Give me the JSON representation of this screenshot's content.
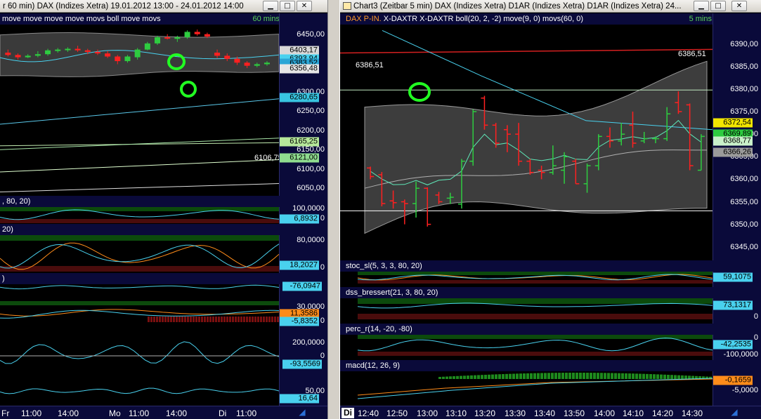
{
  "left": {
    "title": "r 60 min)  DAX (Indizes Xetra) 19.01.2012 13:00 - 24.01.2012 14:00",
    "price": {
      "header": "move move move move movs boll move movs",
      "timeframe": "60 mins",
      "ticks": [
        "6450,00",
        "6300,00",
        "6250,00",
        "6200,00",
        "6150,00",
        "6100,00",
        "6050,00"
      ],
      "tags": [
        {
          "text": "6403,17",
          "color": "#d8d8d8"
        },
        {
          "text": "6393,94",
          "color": "#49d1ee"
        },
        {
          "text": "6383,52",
          "color": "#2aa6d6"
        },
        {
          "text": "6356,48",
          "color": "#e6e6e6"
        },
        {
          "text": "6280,65",
          "color": "#38c4e0"
        },
        {
          "text": "6165,25",
          "color": "#b6e89a"
        },
        {
          "text": "6121,00",
          "color": "#8fdc8f"
        }
      ],
      "inline_label": "6106,75",
      "candles": [
        [
          6402,
          6410,
          6392,
          6396
        ],
        [
          6396,
          6400,
          6384,
          6390
        ],
        [
          6390,
          6398,
          6388,
          6394
        ],
        [
          6394,
          6406,
          6390,
          6398
        ],
        [
          6398,
          6412,
          6394,
          6408
        ],
        [
          6408,
          6414,
          6402,
          6410
        ],
        [
          6410,
          6416,
          6404,
          6412
        ],
        [
          6412,
          6420,
          6404,
          6408
        ],
        [
          6408,
          6412,
          6398,
          6404
        ],
        [
          6404,
          6410,
          6396,
          6400
        ],
        [
          6400,
          6406,
          6388,
          6392
        ],
        [
          6392,
          6396,
          6372,
          6380
        ],
        [
          6380,
          6396,
          6376,
          6392
        ],
        [
          6390,
          6414,
          6384,
          6410
        ],
        [
          6410,
          6430,
          6408,
          6426
        ],
        [
          6426,
          6446,
          6422,
          6442
        ],
        [
          6442,
          6450,
          6436,
          6440
        ],
        [
          6438,
          6446,
          6430,
          6442
        ],
        [
          6442,
          6460,
          6438,
          6456
        ],
        [
          6456,
          6462,
          6446,
          6450
        ],
        [
          6450,
          6454,
          6440,
          6444
        ],
        [
          6402,
          6410,
          6388,
          6394
        ],
        [
          6394,
          6400,
          6380,
          6386
        ],
        [
          6386,
          6392,
          6370,
          6376
        ],
        [
          6376,
          6380,
          6362,
          6368
        ],
        [
          6368,
          6376,
          6364,
          6372
        ],
        [
          6372,
          6380,
          6368,
          6376
        ]
      ],
      "ylim": [
        6030,
        6475
      ]
    },
    "ind1": {
      "header": ", 80, 20)",
      "ticks": [
        "100,0000",
        "0"
      ],
      "tag": "6,8932",
      "tag_color": "#49d1ee"
    },
    "ind2": {
      "header": "20)",
      "ticks": [
        "80,0000",
        "0"
      ],
      "tag": "18,2027",
      "tag_color": "#49d1ee"
    },
    "ind3": {
      "header": ")",
      "tag": "-76,0947",
      "tag_color": "#49d1ee"
    },
    "ind4": {
      "ticks": [
        "30,0000",
        "0"
      ],
      "tags": [
        {
          "text": "11,3586",
          "color": "#ff8c1a"
        },
        {
          "text": "-5,8352",
          "color": "#49d1ee"
        }
      ]
    },
    "ind5": {
      "ticks": [
        "200,0000",
        "0"
      ],
      "tag": "-93,5569",
      "tag_color": "#49d1ee"
    },
    "ind6": {
      "ticks": [
        "50,00"
      ],
      "tag": "16,64",
      "tag_color": "#49d1ee"
    },
    "time": [
      "Fr",
      "11:00",
      "14:00",
      "Mo",
      "11:00",
      "14:00",
      "Di",
      "11:00"
    ]
  },
  "right": {
    "title": "Chart3 (Zeitbar 5 min)  DAX (Indizes Xetra) D1AR (Indizes Xetra) D1AR (Indizes Xetra) 24...",
    "price": {
      "header_orange": "DAX P-IN.",
      "header": " X-DAXTR X-DAXTR boll(20, 2, -2) move(9, 0) movs(60, 0)",
      "timeframe": "5 mins",
      "ticks": [
        "6390,00",
        "6385,00",
        "6380,00",
        "6375,00",
        "6370,00",
        "6365,00",
        "6360,00",
        "6355,00",
        "6350,00",
        "6345,00"
      ],
      "tags": [
        {
          "text": "6372,54",
          "color": "#f2e600"
        },
        {
          "text": "6369,89",
          "color": "#2ecc40"
        },
        {
          "text": "6368,77",
          "color": "#c9f0c9"
        },
        {
          "text": "6366,26",
          "color": "#9a9a9a"
        }
      ],
      "label_left": "6386,51",
      "label_right": "6386,51",
      "red_line_value": 6388.0,
      "white_line_upper": 6379.8,
      "white_line_lower": 6353.0,
      "ylim": [
        6342,
        6394
      ],
      "bars": [
        [
          6362.5,
          6362.8,
          6360.0,
          6360.6
        ],
        [
          6361.0,
          6361.6,
          6354.0,
          6354.6
        ],
        [
          6355.2,
          6357.5,
          6353.5,
          6354.8
        ],
        [
          6355.0,
          6355.5,
          6350.0,
          6354.6
        ],
        [
          6354.6,
          6359.5,
          6351.5,
          6358.0
        ],
        [
          6358.0,
          6358.2,
          6349.5,
          6350.0
        ],
        [
          6356.5,
          6357.2,
          6354.5,
          6355.0
        ],
        [
          6355.8,
          6357.0,
          6354.5,
          6356.0
        ],
        [
          6354.5,
          6364.5,
          6353.5,
          6364.0
        ],
        [
          6364.0,
          6375.5,
          6363.0,
          6375.0
        ],
        [
          6378.0,
          6378.5,
          6371.0,
          6372.0
        ],
        [
          6372.0,
          6372.5,
          6367.0,
          6368.0
        ],
        [
          6371.0,
          6372.0,
          6366.0,
          6370.0
        ],
        [
          6370.0,
          6372.5,
          6363.0,
          6364.0
        ],
        [
          6364.0,
          6364.5,
          6361.0,
          6361.5
        ],
        [
          6362.0,
          6363.0,
          6360.0,
          6361.5
        ],
        [
          6361.5,
          6367.5,
          6361.0,
          6363.0
        ],
        [
          6362.0,
          6366.0,
          6359.0,
          6365.0
        ],
        [
          6364.0,
          6364.5,
          6359.0,
          6359.0
        ],
        [
          6359.0,
          6363.5,
          6357.0,
          6363.0
        ],
        [
          6363.0,
          6370.0,
          6362.0,
          6369.5
        ],
        [
          6369.5,
          6371.5,
          6367.0,
          6368.5
        ],
        [
          6368.5,
          6372.5,
          6367.5,
          6370.0
        ],
        [
          6372.0,
          6375.0,
          6367.0,
          6368.0
        ],
        [
          6368.5,
          6370.5,
          6368.0,
          6369.0
        ],
        [
          6369.0,
          6369.5,
          6368.0,
          6369.0
        ],
        [
          6369.0,
          6376.0,
          6368.5,
          6374.5
        ],
        [
          6377.0,
          6379.5,
          6374.5,
          6375.0
        ],
        [
          6376.5,
          6376.8,
          6362.0,
          6363.0
        ],
        [
          6362.0,
          6370.0,
          6362.0,
          6369.5
        ]
      ]
    },
    "ind1": {
      "header": "stoc_sl(5, 3, 3, 80, 20)",
      "tag": "59,1075",
      "tag_color": "#49d1ee"
    },
    "ind2": {
      "header": "dss_bressert(21, 3, 80, 20)",
      "ticks": [
        "0"
      ],
      "tag": "73,1317",
      "tag_color": "#49d1ee"
    },
    "ind3": {
      "header": "perc_r(14, -20, -80)",
      "ticks": [
        "0",
        "-100,0000"
      ],
      "tag": "-42,2535",
      "tag_color": "#49d1ee"
    },
    "ind4": {
      "header": "macd(12, 26, 9)",
      "ticks": [
        "-5,0000"
      ],
      "tag": "-0,1659",
      "tag_color": "#ff8c1a"
    },
    "time_day": "Di",
    "time": [
      "12:40",
      "12:50",
      "13:00",
      "13:10",
      "13:20",
      "13:30",
      "13:40",
      "13:50",
      "14:00",
      "14:10",
      "14:20",
      "14:30"
    ]
  }
}
